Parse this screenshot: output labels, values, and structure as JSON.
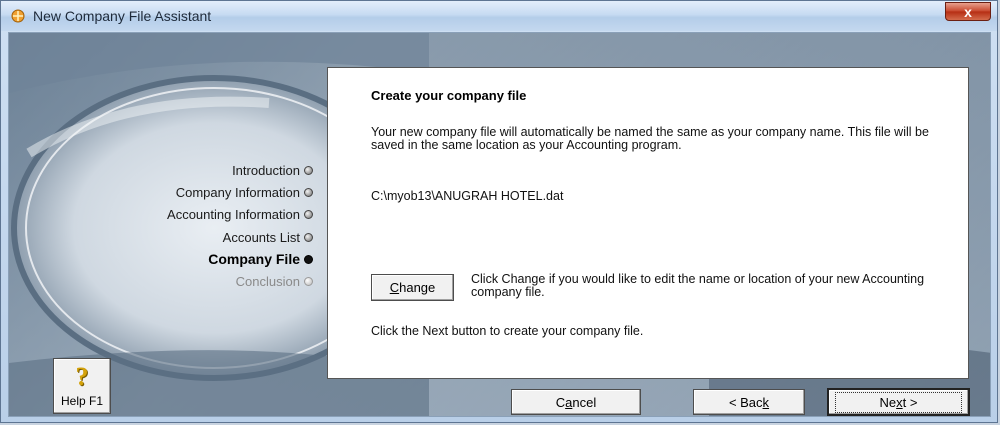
{
  "window": {
    "title": "New Company File Assistant",
    "close_label": "x"
  },
  "nav": {
    "items": [
      {
        "label": "Introduction",
        "state": "normal"
      },
      {
        "label": "Company Information",
        "state": "normal"
      },
      {
        "label": "Accounting Information",
        "state": "normal"
      },
      {
        "label": "Accounts List",
        "state": "normal"
      },
      {
        "label": "Company File",
        "state": "active"
      },
      {
        "label": "Conclusion",
        "state": "disabled"
      }
    ]
  },
  "panel": {
    "heading": "Create your company file",
    "description": "Your new company file will automatically be named the same as your company name.  This file will be saved in the same location as your Accounting program.",
    "file_path": "C:\\myob13\\ANUGRAH HOTEL.dat",
    "change_label_key": "C",
    "change_label_rest": "hange",
    "change_text": "Click Change if you would like to edit the name or location of your new Accounting company file.",
    "next_text": "Click the Next button to create your company file."
  },
  "footer": {
    "help_label": "Help F1",
    "help_icon": "question-mark-icon",
    "cancel_pre": "C",
    "cancel_key": "a",
    "cancel_post": "ncel",
    "back_pre": "< Bac",
    "back_key": "k",
    "back_post": "",
    "next_pre": "Ne",
    "next_key": "x",
    "next_post": "t >"
  }
}
